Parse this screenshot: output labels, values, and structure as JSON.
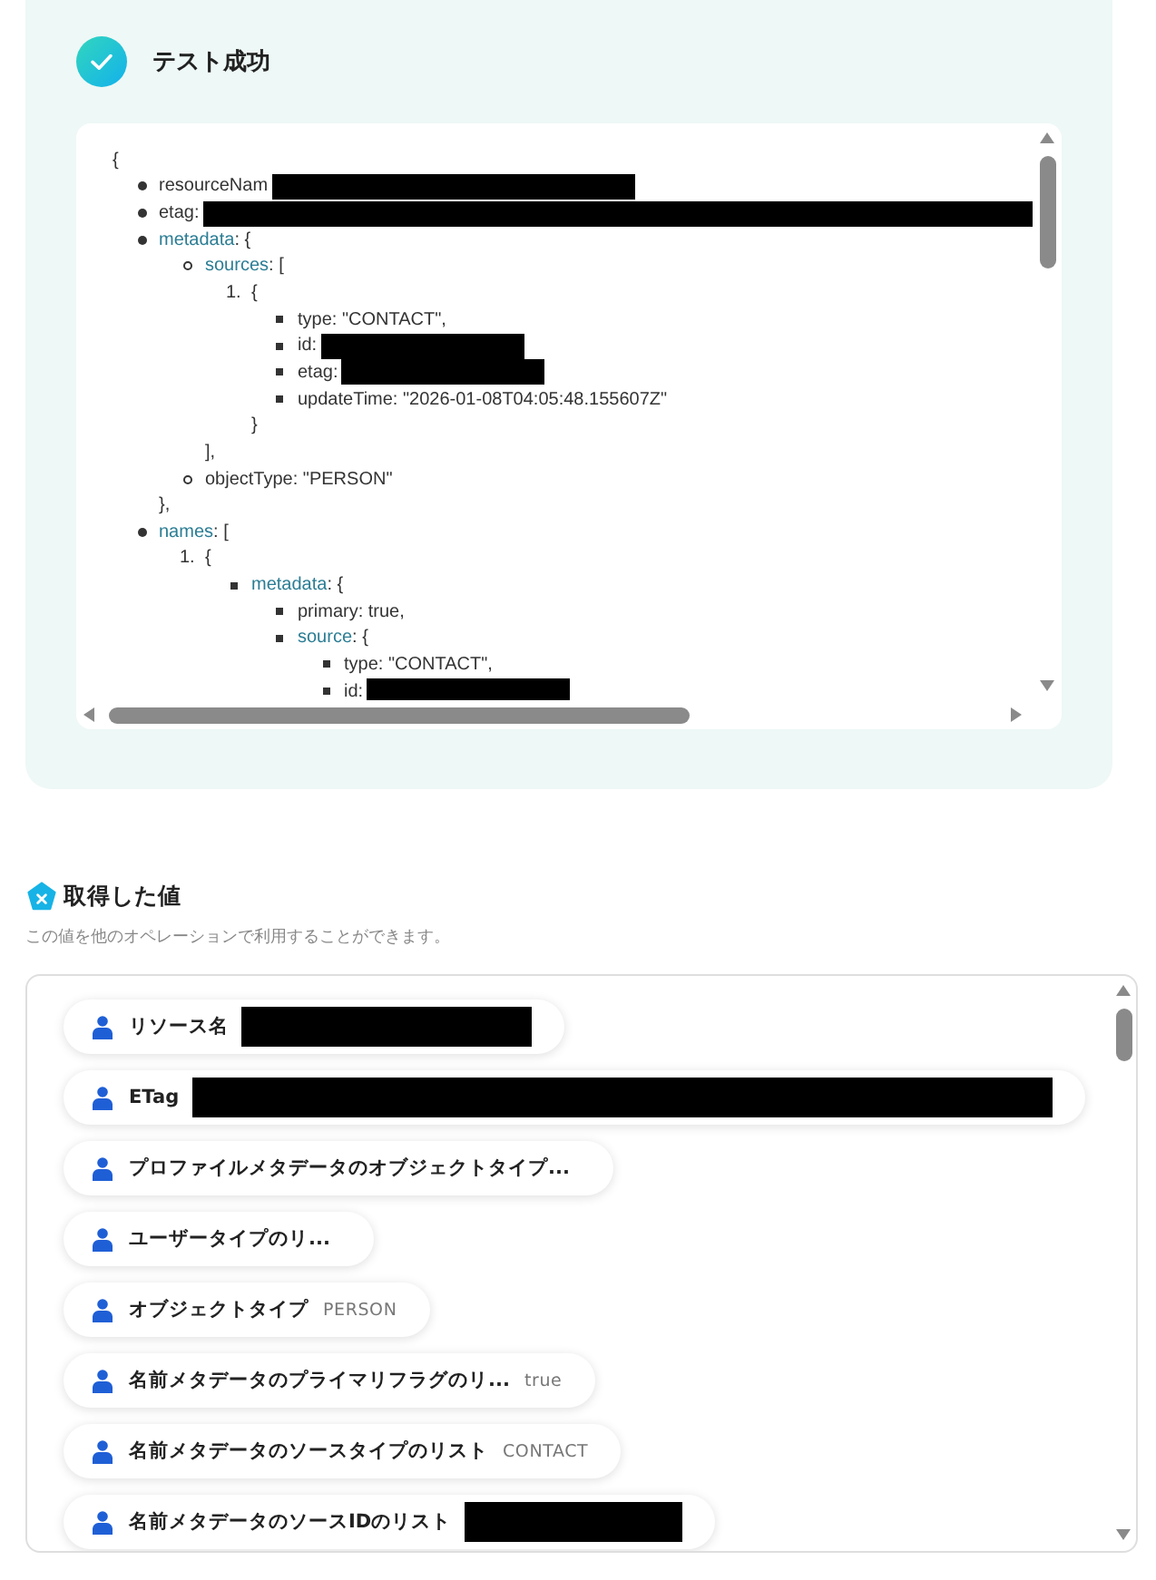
{
  "test_result": {
    "title": "テスト成功",
    "viewer": {
      "open": "{",
      "items": [
        {
          "text": "resourceNam",
          "kind": "masked_mid"
        },
        {
          "text": "etag:",
          "kind": "masked_wide"
        },
        {
          "key": "metadata",
          "text": ": {",
          "children": [
            {
              "key": "sources",
              "text": ": [",
              "children": [
                {
                  "number": "1.",
                  "text": "{",
                  "children": [
                    {
                      "text": "type: \"CONTACT\","
                    },
                    {
                      "text": "id:",
                      "kind": "masked_narrow"
                    },
                    {
                      "text": "etag:",
                      "kind": "masked_narrow"
                    },
                    {
                      "text": "updateTime: \"2026-01-08T04:05:48.155607Z\""
                    }
                  ],
                  "close": "}"
                }
              ],
              "close": "],"
            },
            {
              "text": "objectType: \"PERSON\""
            }
          ],
          "close": "},"
        },
        {
          "key": "names",
          "text": ": [",
          "children": [
            {
              "number": "1.",
              "text": "{",
              "children": [
                {
                  "key": "metadata",
                  "text": ": {",
                  "children": [
                    {
                      "text": "primary: true,"
                    },
                    {
                      "key": "source",
                      "text": ": {",
                      "children": [
                        {
                          "text": "type: \"CONTACT\","
                        },
                        {
                          "text": "id:",
                          "kind": "masked_narrow"
                        }
                      ]
                    }
                  ]
                }
              ]
            }
          ]
        }
      ]
    }
  },
  "output": {
    "title": "取得した値",
    "description": "この値を他のオペレーションで利用することができます。",
    "chips": [
      {
        "label": "リソース名",
        "kind": "masked_mid"
      },
      {
        "label": "ETag",
        "kind": "masked_wide"
      },
      {
        "label": "プロファイルメタデータのオブジェクトタイプ...",
        "kind": "plain"
      },
      {
        "label": "ユーザータイプのリ...",
        "kind": "plain"
      },
      {
        "label": "オブジェクトタイプ",
        "kind": "plain",
        "value": "PERSON"
      },
      {
        "label": "名前メタデータのプライマリフラグのリ...",
        "kind": "plain",
        "value": "true"
      },
      {
        "label": "名前メタデータのソースタイプのリスト",
        "kind": "plain",
        "value": "CONTACT"
      },
      {
        "label": "名前メタデータのソースIDのリスト",
        "kind": "masked_narrow"
      }
    ]
  }
}
